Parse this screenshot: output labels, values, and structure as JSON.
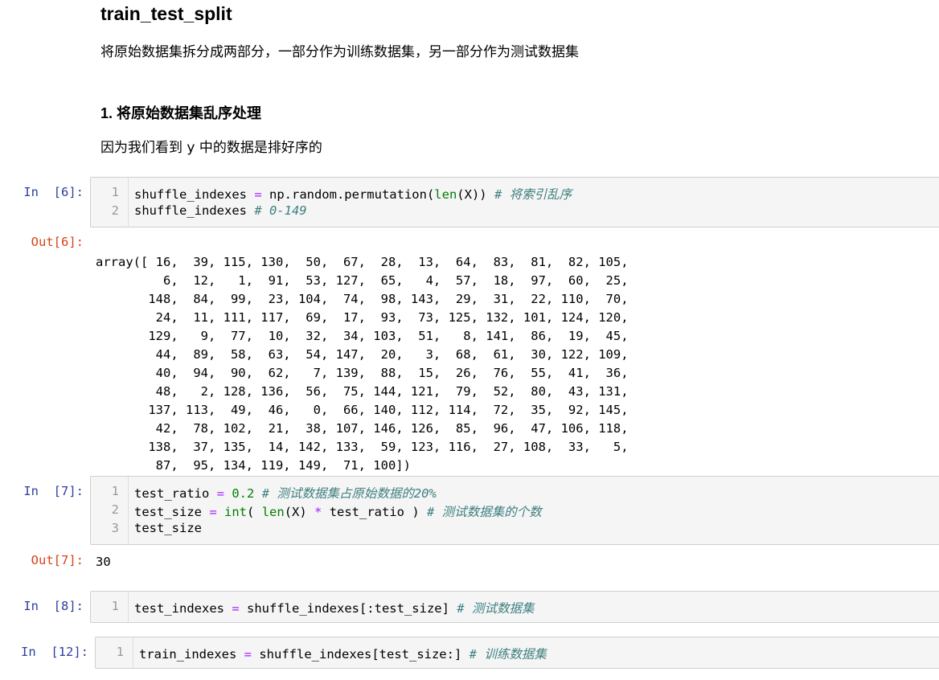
{
  "markdown": {
    "heading": "train_test_split",
    "intro": "将原始数据集拆分成两部分，一部分作为训练数据集，另一部分作为测试数据集",
    "step1_heading": "1. 将原始数据集乱序处理",
    "step1_text": "因为我们看到 y 中的数据是排好序的"
  },
  "cells": [
    {
      "in_prompt": "In  [6]:",
      "lines": [
        {
          "n": "1",
          "parts": [
            "shuffle_indexes ",
            "=",
            " np.random.permutation(",
            "len",
            "(X)) ",
            "# 将索引乱序"
          ]
        },
        {
          "n": "2",
          "parts": [
            "shuffle_indexes ",
            "# 0-149"
          ]
        }
      ],
      "out_prompt": "Out[6]:",
      "output_lines": [
        "array([ 16,  39, 115, 130,  50,  67,  28,  13,  64,  83,  81,  82, 105,",
        "         6,  12,   1,  91,  53, 127,  65,   4,  57,  18,  97,  60,  25,",
        "       148,  84,  99,  23, 104,  74,  98, 143,  29,  31,  22, 110,  70,",
        "        24,  11, 111, 117,  69,  17,  93,  73, 125, 132, 101, 124, 120,",
        "       129,   9,  77,  10,  32,  34, 103,  51,   8, 141,  86,  19,  45,",
        "        44,  89,  58,  63,  54, 147,  20,   3,  68,  61,  30, 122, 109,",
        "        40,  94,  90,  62,   7, 139,  88,  15,  26,  76,  55,  41,  36,",
        "        48,   2, 128, 136,  56,  75, 144, 121,  79,  52,  80,  43, 131,",
        "       137, 113,  49,  46,   0,  66, 140, 112, 114,  72,  35,  92, 145,",
        "        42,  78, 102,  21,  38, 107, 146, 126,  85,  96,  47, 106, 118,",
        "       138,  37, 135,  14, 142, 133,  59, 123, 116,  27, 108,  33,   5,",
        "        87,  95, 134, 119, 149,  71, 100])"
      ]
    },
    {
      "in_prompt": "In  [7]:",
      "lines": [
        {
          "n": "1",
          "parts": [
            "test_ratio ",
            "=",
            " ",
            "0.2",
            " ",
            "# 测试数据集占原始数据的20%"
          ]
        },
        {
          "n": "2",
          "parts": [
            "test_size ",
            "=",
            " ",
            "int",
            "( ",
            "len",
            "(X) ",
            "*",
            " test_ratio ) ",
            "# 测试数据集的个数"
          ]
        },
        {
          "n": "3",
          "parts": [
            "test_size"
          ]
        }
      ],
      "out_prompt": "Out[7]:",
      "output_lines": [
        "30"
      ]
    },
    {
      "in_prompt": "In  [8]:",
      "lines": [
        {
          "n": "1",
          "parts": [
            "test_indexes ",
            "=",
            " shuffle_indexes[:test_size] ",
            "# 测试数据集"
          ]
        }
      ]
    },
    {
      "in_prompt": "In  [12]:",
      "lines": [
        {
          "n": "1",
          "parts": [
            "train_indexes ",
            "=",
            " shuffle_indexes",
            "[",
            "test_size:",
            "]",
            " ",
            "# 训练数据集"
          ]
        }
      ]
    }
  ],
  "colors": {
    "in_prompt": "#303f9f",
    "out_prompt": "#d84315",
    "operator": "#aa22ff",
    "builtin_number": "#008000",
    "comment": "#408080",
    "cell_bg": "#f5f5f5",
    "cell_border": "#cfcfcf"
  }
}
